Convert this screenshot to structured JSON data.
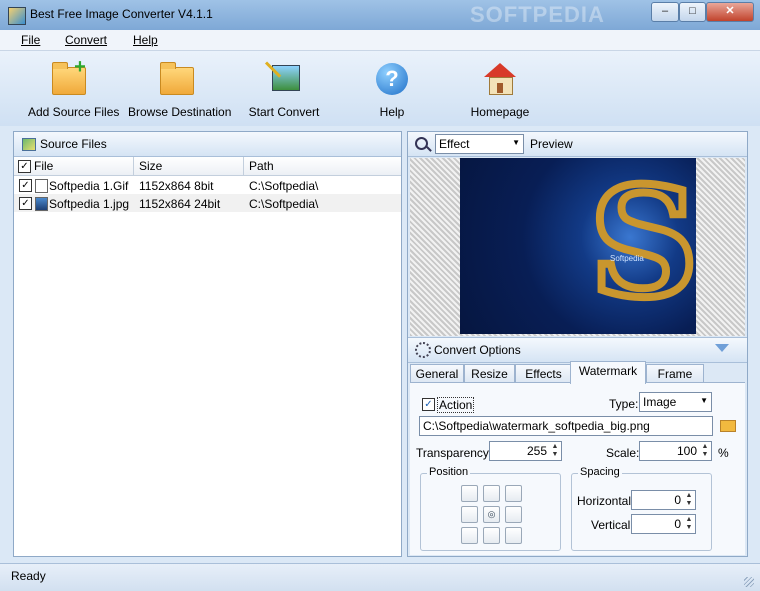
{
  "window": {
    "title": "Best Free Image Converter V4.1.1",
    "watermark": "SOFTPEDIA",
    "min": "–",
    "max": "□",
    "close": "✕"
  },
  "menu": [
    {
      "label": "File"
    },
    {
      "label": "Convert"
    },
    {
      "label": "Help"
    }
  ],
  "toolbar": {
    "add_source_files": "Add Source Files",
    "browse_destination": "Browse Destination",
    "start_convert": "Start Convert",
    "help": "Help",
    "homepage": "Homepage"
  },
  "source_files": {
    "title": "Source Files",
    "columns": {
      "file": "File",
      "size": "Size",
      "path": "Path"
    },
    "rows": [
      {
        "file": "Softpedia 1.Gif",
        "size": "1152x864  8bit",
        "path": "C:\\Softpedia\\",
        "checked": true
      },
      {
        "file": "Softpedia 1.jpg",
        "size": "1152x864  24bit",
        "path": "C:\\Softpedia\\",
        "checked": true
      }
    ]
  },
  "preview": {
    "effect_value": "Effect",
    "label": "Preview",
    "image_text": "Softpedia"
  },
  "convert_options": {
    "title": "Convert Options",
    "tabs": [
      "General",
      "Resize",
      "Effects",
      "Watermark",
      "Frame"
    ],
    "active_tab": "Watermark",
    "watermark": {
      "action_label": "Action",
      "action_checked": true,
      "type_label": "Type:",
      "type_value": "Image",
      "file_path": "C:\\Softpedia\\watermark_softpedia_big.png",
      "transparency_label": "Transparency:",
      "transparency_value": "255",
      "scale_label": "Scale:",
      "scale_value": "100",
      "scale_unit": "%",
      "position_label": "Position",
      "spacing_label": "Spacing",
      "horizontal_label": "Horizontal:",
      "horizontal_value": "0",
      "vertical_label": "Vertical:",
      "vertical_value": "0"
    }
  },
  "status": {
    "text": "Ready"
  }
}
